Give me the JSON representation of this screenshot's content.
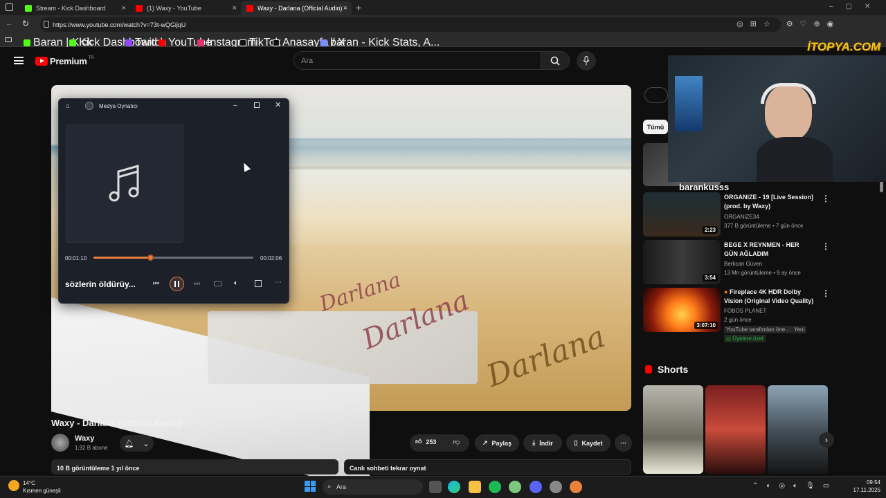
{
  "browser": {
    "tabs": [
      {
        "title": "Stream - Kick Dashboard",
        "color": "#53fc18"
      },
      {
        "title": "(1) Waxy - YouTube",
        "color": "#ff0000"
      },
      {
        "title": "Waxy - Darlana (Official Audio) -",
        "color": "#ff0000"
      }
    ],
    "url": "https://www.youtube.com/watch?v=73t-wQGijqU",
    "bookmarks": [
      {
        "label": "Baran | Kick",
        "color": "#53fc18"
      },
      {
        "label": "Kick Dashboard",
        "color": "#53fc18"
      },
      {
        "label": "Twitch",
        "color": "#9146ff"
      },
      {
        "label": "YouTube",
        "color": "#ff0000"
      },
      {
        "label": "Instagram",
        "color": "#e1306c"
      },
      {
        "label": "TikTok",
        "color": "#ffffff"
      },
      {
        "label": "Anasayfa / X",
        "color": "#ffffff"
      },
      {
        "label": "baran - Kick Stats, A...",
        "color": "#7b8cff"
      }
    ]
  },
  "yt": {
    "logo": "Premium",
    "region": "TR",
    "search_placeholder": "Ara"
  },
  "player": {
    "window_title": "Medya Oynatıcı",
    "elapsed": "00:01:10",
    "total": "00:02:06",
    "progress": 0.36,
    "song": "sözlerin öldürüy..."
  },
  "video": {
    "title": "Waxy - Darlana (Official Audio)",
    "channel": "Waxy",
    "subscribers": "1,92 B abone",
    "likes": "253",
    "share": "Paylaş",
    "download": "İndir",
    "save": "Kaydet",
    "description": "10 B görüntüleme  1 yıl önce",
    "chat": "Canlı sohbeti tekrar oynat"
  },
  "sidebar": {
    "chip": "Tümü",
    "recs": [
      {
        "title": "ORGANIZE - 19 [Live Session] (prod. by Waxy)",
        "channel": "ORGANIZE34",
        "meta": "377 B görüntüleme • 7 gün önce",
        "duration": "2:23"
      },
      {
        "title": "BEGE X REYNMEN - HER GÜN AĞLADIM",
        "channel": "Berkcan Güven",
        "meta": "13 Mn görüntüleme • 9 ay önce",
        "duration": "3:54"
      },
      {
        "title": "Fireplace 4K HDR Dolby Vision (Original Video Quality)",
        "channel": "FOBOS PLANET",
        "meta": "2 gün önce",
        "duration": "3:07:10",
        "badge1": "YouTube tarafından öne...",
        "badge2": "Yeni",
        "members": "Üyelere özel"
      }
    ],
    "shorts_heading": "Shorts"
  },
  "overlay": {
    "logo": "İTOPYA.COM",
    "streamer": "barankusss"
  },
  "taskbar": {
    "temp": "14°C",
    "weather": "Kısmen güneşli",
    "search": "Ara",
    "time": "09:54",
    "date": "17.11.2025"
  }
}
